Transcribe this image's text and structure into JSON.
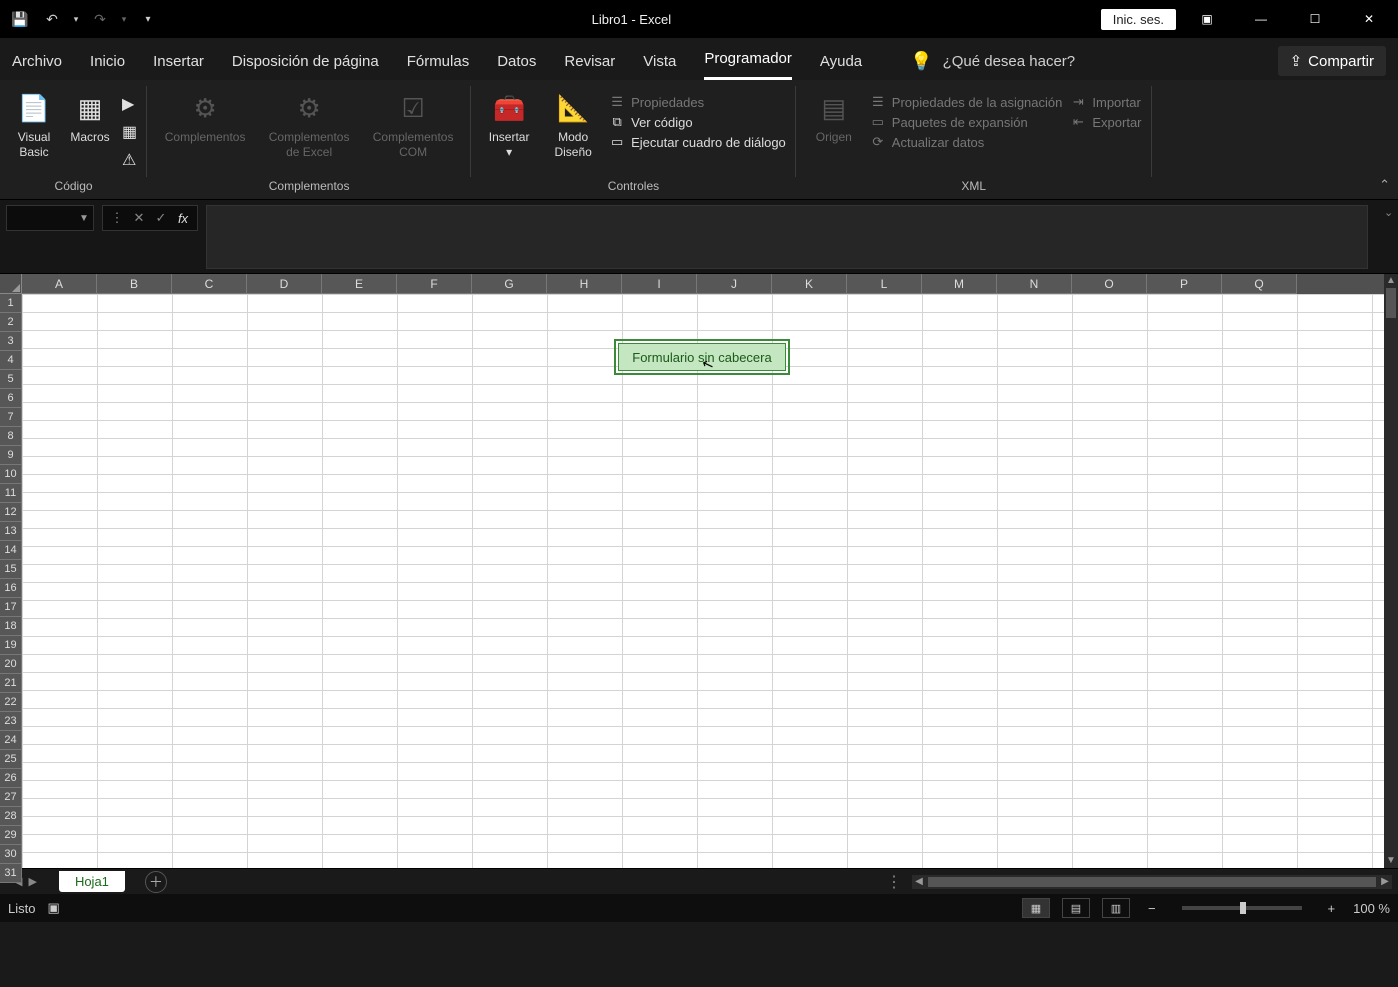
{
  "titlebar": {
    "title": "Libro1  -  Excel",
    "signin": "Inic. ses."
  },
  "tabs": {
    "items": [
      "Archivo",
      "Inicio",
      "Insertar",
      "Disposición de página",
      "Fórmulas",
      "Datos",
      "Revisar",
      "Vista",
      "Programador",
      "Ayuda"
    ],
    "active_index": 8,
    "tellme": "¿Qué desea hacer?",
    "share": "Compartir"
  },
  "ribbon": {
    "group_codigo": {
      "label": "Código",
      "visual_basic": "Visual\nBasic",
      "macros": "Macros"
    },
    "group_complementos": {
      "label": "Complementos",
      "complementos": "Complementos",
      "comp_excel": "Complementos\nde Excel",
      "comp_com": "Complementos\nCOM"
    },
    "group_controles": {
      "label": "Controles",
      "insertar": "Insertar",
      "modo_diseno": "Modo\nDiseño",
      "propiedades": "Propiedades",
      "ver_codigo": "Ver código",
      "ejecutar_dialogo": "Ejecutar cuadro de diálogo"
    },
    "group_xml": {
      "label": "XML",
      "origen": "Origen",
      "prop_asig": "Propiedades de la asignación",
      "paquetes": "Paquetes de expansión",
      "actualizar": "Actualizar datos",
      "importar": "Importar",
      "exportar": "Exportar"
    }
  },
  "formula_bar": {
    "name": "",
    "fx": "fx"
  },
  "grid": {
    "columns": [
      "A",
      "B",
      "C",
      "D",
      "E",
      "F",
      "G",
      "H",
      "I",
      "J",
      "K",
      "L",
      "M",
      "N",
      "O",
      "P",
      "Q"
    ],
    "rows": 31,
    "button_text": "Formulario sin cabecera"
  },
  "sheets": {
    "tab1": "Hoja1"
  },
  "status": {
    "ready": "Listo",
    "zoom": "100 %"
  }
}
